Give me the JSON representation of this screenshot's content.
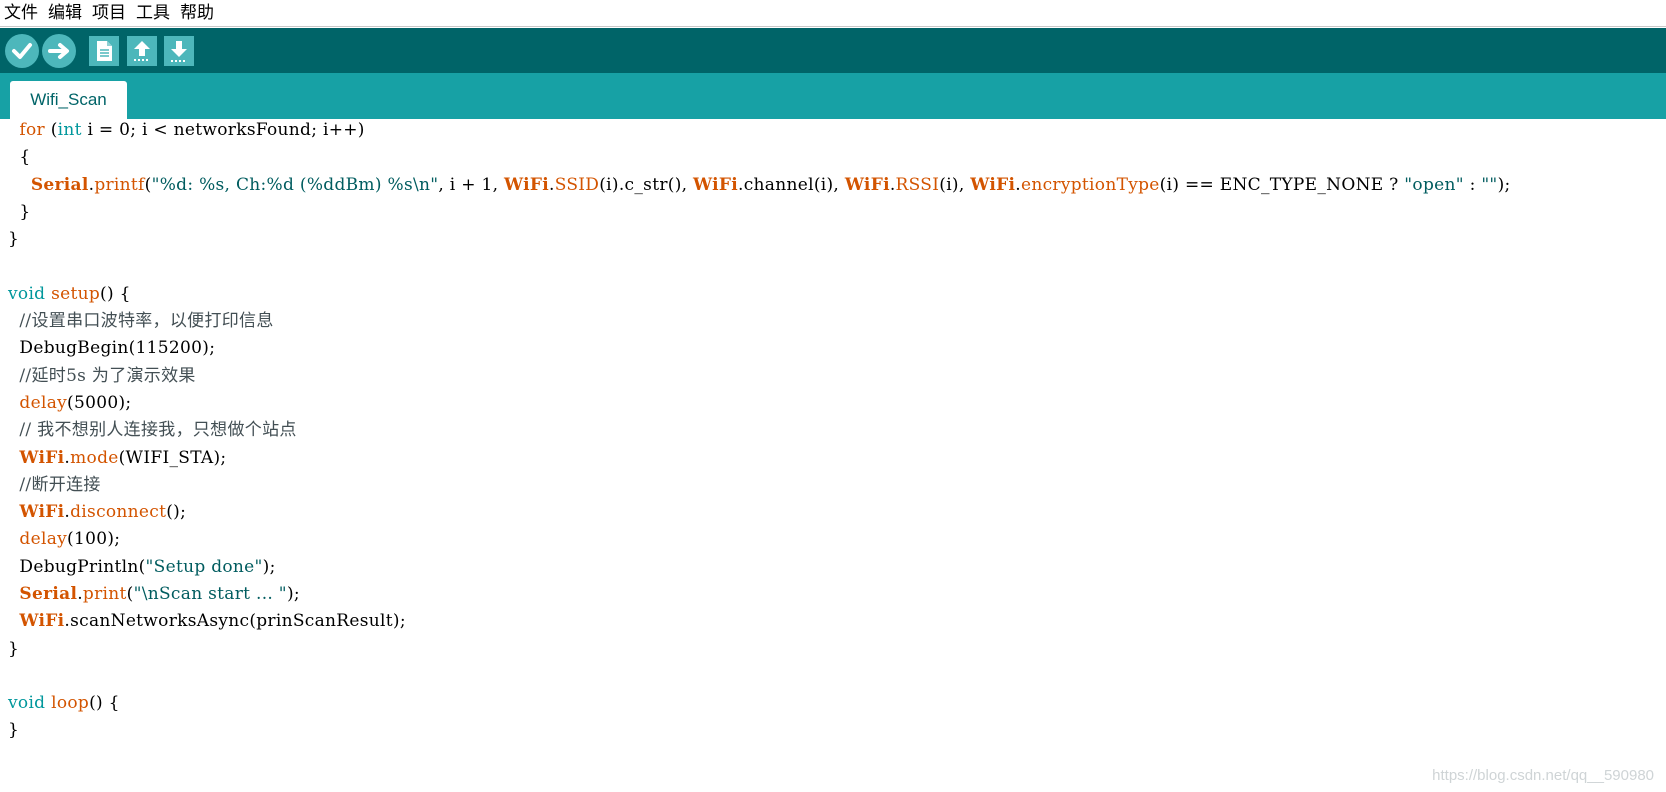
{
  "menu": [
    "文件",
    "编辑",
    "项目",
    "工具",
    "帮助"
  ],
  "toolbar": {
    "verify_icon": "check-icon",
    "upload_icon": "arrow-right-icon",
    "new_icon": "document-icon",
    "open_icon": "arrow-up-icon",
    "save_icon": "arrow-down-icon"
  },
  "tab": {
    "label": "Wifi_Scan"
  },
  "code": {
    "l1": {
      "a": "  ",
      "b": "for",
      "c": " (",
      "d": "int",
      "e": " i = 0; i < networksFound; i++)"
    },
    "l2": "  {",
    "l3": {
      "a": "    ",
      "b": "Serial",
      "c": ".",
      "d": "printf",
      "e": "(",
      "f": "\"%d: %s, Ch:%d (%ddBm) %s\\n\"",
      "g": ", i + 1, ",
      "h": "WiFi",
      "i": ".",
      "j": "SSID",
      "k": "(i).c_str(), ",
      "l": "WiFi",
      "m": ".channel(i), ",
      "n": "WiFi",
      "o": ".",
      "p": "RSSI",
      "q": "(i), ",
      "r": "WiFi",
      "s": ".",
      "t": "encryptionType",
      "u": "(i) == ENC_TYPE_NONE ? ",
      "v": "\"open\"",
      "w": " : ",
      "x": "\"\"",
      "y": ");"
    },
    "l4": "  }",
    "l5": "}",
    "l7": {
      "a": "void",
      "b": " ",
      "c": "setup",
      "d": "() {"
    },
    "l8": "  //设置串口波特率，以便打印信息",
    "l9": "  DebugBegin(115200);",
    "l10": "  //延时5s 为了演示效果",
    "l11": {
      "a": "  ",
      "b": "delay",
      "c": "(5000);"
    },
    "l12": "  // 我不想别人连接我，只想做个站点",
    "l13": {
      "a": "  ",
      "b": "WiFi",
      "c": ".",
      "d": "mode",
      "e": "(WIFI_STA);"
    },
    "l14": "  //断开连接",
    "l15": {
      "a": "  ",
      "b": "WiFi",
      "c": ".",
      "d": "disconnect",
      "e": "();"
    },
    "l16": {
      "a": "  ",
      "b": "delay",
      "c": "(100);"
    },
    "l17": {
      "a": "  DebugPrintln(",
      "b": "\"Setup done\"",
      "c": ");"
    },
    "l18": {
      "a": "  ",
      "b": "Serial",
      "c": ".",
      "d": "print",
      "e": "(",
      "f": "\"\\nScan start ... \"",
      "g": ");"
    },
    "l19": {
      "a": "  ",
      "b": "WiFi",
      "c": ".scanNetworksAsync(prinScanResult);"
    },
    "l20": "}",
    "l22": {
      "a": "void",
      "b": " ",
      "c": "loop",
      "d": "() {"
    },
    "l23": "}"
  },
  "watermark": "https://blog.csdn.net/qq__590980",
  "colors": {
    "toolbar": "#006468",
    "tabbar": "#17a1a5",
    "button": "#4db7bb",
    "keyword": "#00979c",
    "function": "#d35400",
    "string": "#005c5f"
  }
}
